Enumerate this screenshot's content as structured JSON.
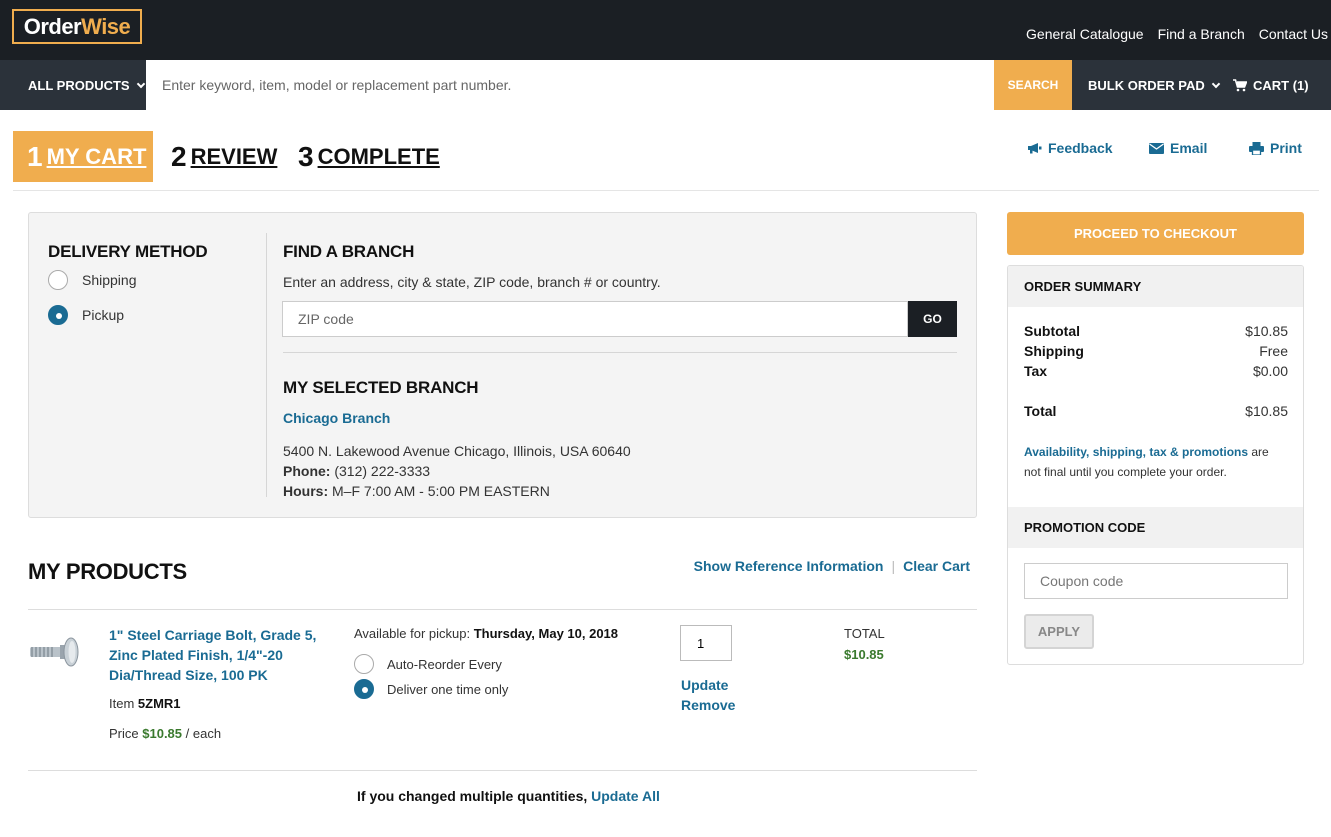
{
  "brand": {
    "part1": "Order",
    "part2": "Wise"
  },
  "header": {
    "links": [
      "General Catalogue",
      "Find a Branch",
      "Contact Us"
    ]
  },
  "nav": {
    "all_products": "ALL PRODUCTS",
    "search_placeholder": "Enter keyword, item, model or replacement part number.",
    "search_button": "SEARCH",
    "bulk_order": "BULK ORDER PAD",
    "cart": "CART (1)"
  },
  "steps": [
    {
      "num": "1",
      "label": "MY CART",
      "active": true
    },
    {
      "num": "2",
      "label": "REVIEW",
      "active": false
    },
    {
      "num": "3",
      "label": "COMPLETE",
      "active": false
    }
  ],
  "tools": {
    "feedback": "Feedback",
    "email": "Email",
    "print": "Print"
  },
  "delivery": {
    "title": "DELIVERY METHOD",
    "options": [
      {
        "label": "Shipping",
        "selected": false
      },
      {
        "label": "Pickup",
        "selected": true
      }
    ]
  },
  "find_branch": {
    "title": "FIND A BRANCH",
    "description": "Enter an address, city & state, ZIP code, branch # or country.",
    "zip_placeholder": "ZIP code",
    "go": "GO"
  },
  "selected_branch": {
    "title": "MY SELECTED BRANCH",
    "name": "Chicago Branch",
    "address": "5400 N. Lakewood Avenue Chicago, Illinois, USA 60640",
    "phone_label": "Phone:",
    "phone": "(312) 222-3333",
    "hours_label": "Hours:",
    "hours": "M–F 7:00 AM - 5:00 PM EASTERN"
  },
  "products": {
    "title": "MY PRODUCTS",
    "show_ref": "Show Reference Information",
    "separator": "|",
    "clear_cart": "Clear Cart",
    "items": [
      {
        "name": "1\" Steel Carriage Bolt, Grade 5, Zinc Plated Finish, 1/4\"-20 Dia/Thread Size, 100 PK",
        "item_label": "Item",
        "item_no": "5ZMR1",
        "price_label": "Price",
        "price": "$10.85",
        "price_unit": "/ each",
        "avail_label": "Available for pickup:",
        "avail_date": "Thursday, May 10, 2018",
        "opt_auto": "Auto-Reorder Every",
        "opt_once": "Deliver one time only",
        "qty": "1",
        "update": "Update",
        "remove": "Remove",
        "total_label": "TOTAL",
        "total": "$10.85"
      }
    ],
    "update_all_text": "If you changed multiple quantities,",
    "update_all_link": "Update All"
  },
  "summary": {
    "checkout": "PROCEED TO CHECKOUT",
    "title": "ORDER SUMMARY",
    "subtotal_label": "Subtotal",
    "subtotal": "$10.85",
    "shipping_label": "Shipping",
    "shipping": "Free",
    "tax_label": "Tax",
    "tax": "$0.00",
    "total_label": "Total",
    "total": "$10.85",
    "note_link": "Availability, shipping, tax & promotions",
    "note_text": " are not final until you complete your order.",
    "promo_title": "PROMOTION CODE",
    "coupon_placeholder": "Coupon code",
    "apply": "APPLY"
  },
  "colors": {
    "accent": "#f0ad4e",
    "link": "#1a6b93",
    "dark": "#1b1f24",
    "nav": "#2b323a",
    "price": "#3a7a2e"
  }
}
